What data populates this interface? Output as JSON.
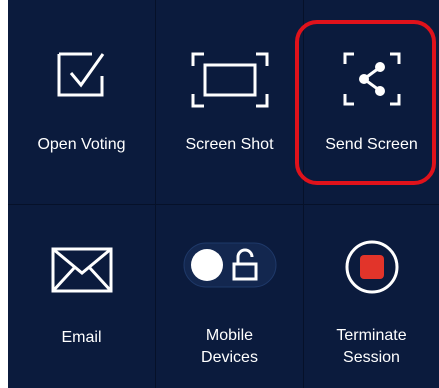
{
  "tiles": {
    "open_voting": {
      "label": "Open Voting",
      "icon": "checkbox-icon"
    },
    "screen_shot": {
      "label": "Screen Shot",
      "icon": "screenshot-frame-icon"
    },
    "send_screen": {
      "label": "Send Screen",
      "icon": "share-icon"
    },
    "email": {
      "label": "Email",
      "icon": "envelope-icon"
    },
    "mobile_devices": {
      "label_line1": "Mobile",
      "label_line2": "Devices",
      "icon": "lock-toggle-icon"
    },
    "terminate_session": {
      "label_line1": "Terminate",
      "label_line2": "Session",
      "icon": "stop-icon"
    }
  },
  "colors": {
    "panel_bg": "#0b1b3d",
    "grid_line": "#061129",
    "highlight": "#e0121b",
    "stop_red": "#e2342a",
    "text": "#ffffff"
  }
}
